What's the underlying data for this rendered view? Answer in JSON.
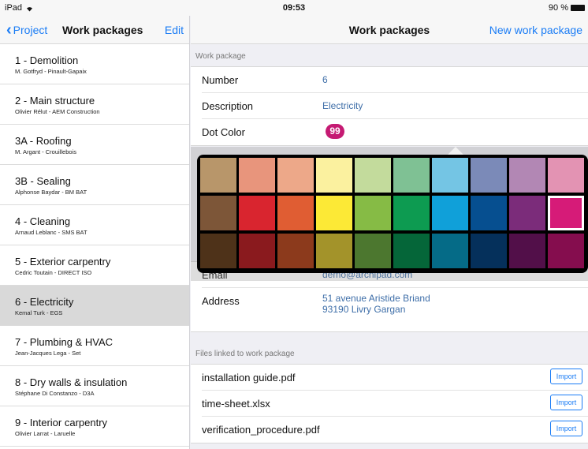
{
  "status_bar": {
    "device": "iPad",
    "time": "09:53",
    "battery": "90 %"
  },
  "left_pane": {
    "back_label": "Project",
    "title": "Work packages",
    "edit_label": "Edit",
    "items": [
      {
        "name": "1 - Demolition",
        "sub": "M. Gotfryd - Pinault-Gapaix"
      },
      {
        "name": "2 - Main structure",
        "sub": "Olivier Rélut - AEM Construction"
      },
      {
        "name": "3A - Roofing",
        "sub": "M. Argant - Crouillebois"
      },
      {
        "name": "3B - Sealing",
        "sub": "Alphonse Baydar - BM BAT"
      },
      {
        "name": "4 - Cleaning",
        "sub": "Arnaud Leblanc - SMS BAT"
      },
      {
        "name": "5 - Exterior carpentry",
        "sub": "Cedric Toutain - DIRECT ISO"
      },
      {
        "name": "6 - Electricity",
        "sub": "Kemal Turk - EGS",
        "selected": true
      },
      {
        "name": "7 - Plumbing & HVAC",
        "sub": "Jean-Jacques Lega - Set"
      },
      {
        "name": "8 - Dry walls & insulation",
        "sub": "Stéphane Di Constanzo - D3A"
      },
      {
        "name": "9 - Interior carpentry",
        "sub": "Olivier Larrat - Laruelle"
      }
    ]
  },
  "right_pane": {
    "title": "Work packages",
    "new_label": "New work package",
    "work_package_header": "Work package",
    "number_label": "Number",
    "number_value": "6",
    "description_label": "Description",
    "description_value": "Electricity",
    "dot_color_label": "Dot Color",
    "dot_value": "99",
    "email_label": "Email",
    "email_value": "demo@archipad.com",
    "address_label": "Address",
    "address_line1": "51 avenue Aristide Briand",
    "address_line2": "93190 Livry Gargan",
    "files_header": "Files linked to work package",
    "import_label": "Import",
    "files": [
      {
        "name": "installation guide.pdf"
      },
      {
        "name": "time-sheet.xlsx"
      },
      {
        "name": "verification_procedure.pdf"
      }
    ]
  },
  "palette": {
    "selected_index": 19,
    "colors": [
      "#b8966a",
      "#e8957c",
      "#eda889",
      "#fbf19f",
      "#c3db9c",
      "#7fc194",
      "#74c5e4",
      "#7b8ab8",
      "#b287b4",
      "#e393b3",
      "#7d5638",
      "#d9252f",
      "#e05d33",
      "#fce936",
      "#86bb45",
      "#0d9b51",
      "#10a0d9",
      "#064f90",
      "#7b2c7a",
      "#d61b78",
      "#4e3219",
      "#8a1a1e",
      "#8c3a1c",
      "#a3932a",
      "#4c772f",
      "#056639",
      "#056b87",
      "#05305b",
      "#520f49",
      "#850d4e"
    ]
  }
}
